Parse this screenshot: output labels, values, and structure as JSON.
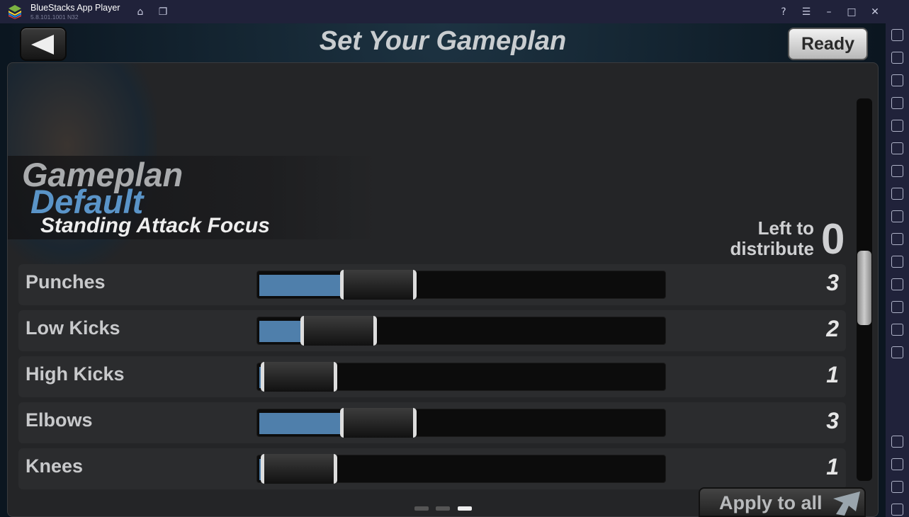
{
  "window": {
    "title": "BlueStacks App Player",
    "version": "5.8.101.1001 N32"
  },
  "titlebar_icons": [
    "home-icon",
    "multi-instance-icon",
    "help-icon",
    "menu-icon",
    "minimize-icon",
    "maximize-icon",
    "close-icon"
  ],
  "sidebar_icons": [
    "fullscreen-icon",
    "volume-mute-icon",
    "cursor-icon",
    "keyboard-icon",
    "record-icon",
    "sync-icon",
    "macro-icon",
    "apk-icon",
    "screenshot-icon",
    "folder-icon",
    "resize-icon",
    "rotate-icon",
    "location-icon",
    "layers-icon",
    "speed-icon",
    "settings-icon",
    "back-icon",
    "home-icon",
    "recent-apps-icon"
  ],
  "header": {
    "title": "Set Your Gameplan",
    "ready_label": "Ready"
  },
  "gameplan": {
    "label": "Gameplan",
    "name": "Default",
    "description": "Standing Attack Focus"
  },
  "distribute": {
    "label_line1": "Left to",
    "label_line2": "distribute",
    "value": "0"
  },
  "sliders": [
    {
      "label": "Punches",
      "value": "3"
    },
    {
      "label": "Low Kicks",
      "value": "2"
    },
    {
      "label": "High Kicks",
      "value": "1"
    },
    {
      "label": "Elbows",
      "value": "3"
    },
    {
      "label": "Knees",
      "value": "1"
    }
  ],
  "footer": {
    "apply_label": "Apply to all",
    "page_count": 3,
    "current_page": 3
  },
  "colors": {
    "accent": "#4f7fab",
    "gameplan_name": "#5a94c8"
  }
}
